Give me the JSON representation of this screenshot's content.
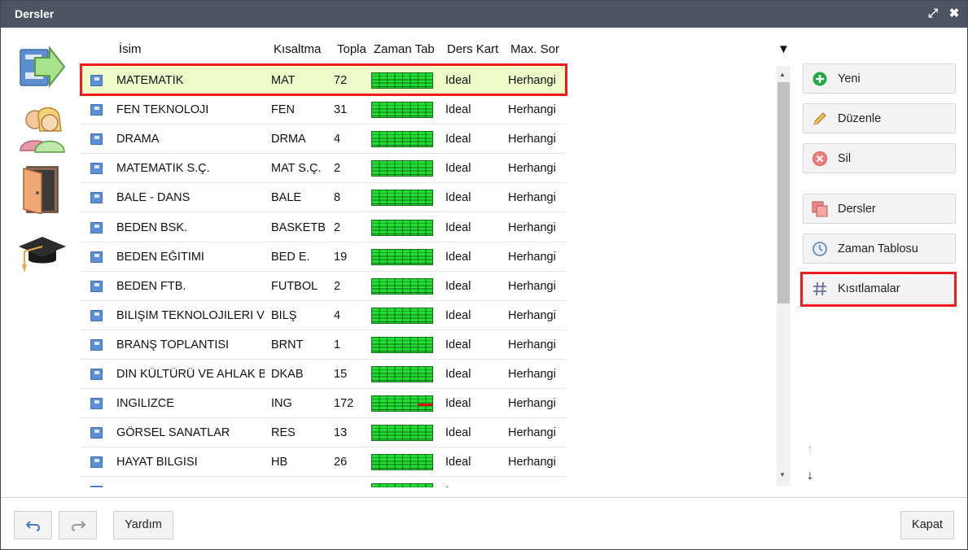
{
  "window": {
    "title": "Dersler"
  },
  "sidebar": {
    "icons": [
      "lessons-arrow-icon",
      "teachers-icon",
      "classroom-door-icon",
      "graduation-cap-icon"
    ]
  },
  "grid": {
    "columns": [
      "İsim",
      "Kısaltma",
      "Topla",
      "Zaman Tab",
      "Ders Kart",
      "Max. Sor"
    ],
    "rows": [
      {
        "name": "MATEMATİK",
        "abbr": "MAT",
        "total": "72",
        "status": "İdeal",
        "max": "Herhangi",
        "selected": true
      },
      {
        "name": "FEN TEKNOLOJİ",
        "abbr": "FEN",
        "total": "31",
        "status": "İdeal",
        "max": "Herhangi"
      },
      {
        "name": "DRAMA",
        "abbr": "DRMA",
        "total": "4",
        "status": "İdeal",
        "max": "Herhangi"
      },
      {
        "name": "MATEMATİK S.Ç.",
        "abbr": "MAT S.Ç.",
        "total": "2",
        "status": "İdeal",
        "max": "Herhangi"
      },
      {
        "name": "BALE - DANS",
        "abbr": "BALE",
        "total": "8",
        "status": "İdeal",
        "max": "Herhangi"
      },
      {
        "name": "BEDEN BSK.",
        "abbr": "BASKETB",
        "total": "2",
        "status": "İdeal",
        "max": "Herhangi"
      },
      {
        "name": "BEDEN EĞİTİMİ",
        "abbr": "BED E.",
        "total": "19",
        "status": "İdeal",
        "max": "Herhangi"
      },
      {
        "name": "BEDEN FTB.",
        "abbr": "FUTBOL",
        "total": "2",
        "status": "İdeal",
        "max": "Herhangi"
      },
      {
        "name": "BİLİŞİM TEKNOLOJİLERİ V",
        "abbr": "BİLŞ",
        "total": "4",
        "status": "İdeal",
        "max": "Herhangi"
      },
      {
        "name": "BRANŞ TOPLANTISI",
        "abbr": "BRNT",
        "total": "1",
        "status": "İdeal",
        "max": "Herhangi"
      },
      {
        "name": "DİN KÜLTÜRÜ VE AHLAK B",
        "abbr": "DKAB",
        "total": "15",
        "status": "İdeal",
        "max": "Herhangi"
      },
      {
        "name": "İNGİLİZCE",
        "abbr": "İNG",
        "total": "172",
        "status": "İdeal",
        "max": "Herhangi",
        "conflict": true
      },
      {
        "name": "GÖRSEL SANATLAR",
        "abbr": "RES",
        "total": "13",
        "status": "İdeal",
        "max": "Herhangi"
      },
      {
        "name": "HAYAT BİLGİSİ",
        "abbr": "HB",
        "total": "26",
        "status": "İdeal",
        "max": "Herhangi"
      },
      {
        "name": "",
        "abbr": "",
        "total": "",
        "status": "İ",
        "max": ""
      }
    ]
  },
  "actions": {
    "new": "Yeni",
    "edit": "Düzenle",
    "delete": "Sil",
    "lessons": "Dersler",
    "timetable": "Zaman Tablosu",
    "constraints": "Kısıtlamalar"
  },
  "footer": {
    "help": "Yardım",
    "close": "Kapat"
  },
  "colors": {
    "titlebar": "#4a5561",
    "selected_row": "#eefbc8",
    "highlight": "#ee1c1c",
    "schedule_green": "#22e033"
  }
}
